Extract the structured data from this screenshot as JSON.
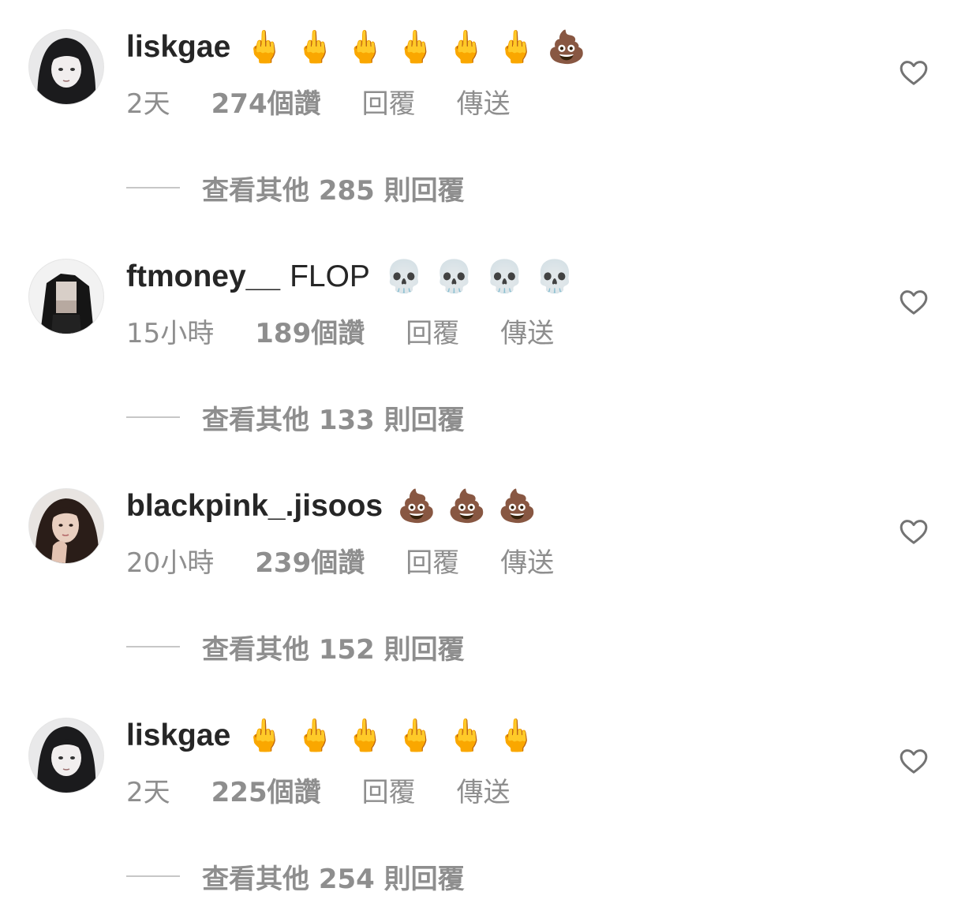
{
  "comments": [
    {
      "username": "liskgae",
      "text": "",
      "emojis": "🖕🖕🖕🖕🖕🖕💩",
      "time": "2天",
      "likes": "274個讚",
      "reply_label": "回覆",
      "send_label": "傳送",
      "view_replies": "查看其他 285 則回覆"
    },
    {
      "username": "ftmoney__",
      "text": "FLOP",
      "emojis": "💀💀💀💀",
      "time": "15小時",
      "likes": "189個讚",
      "reply_label": "回覆",
      "send_label": "傳送",
      "view_replies": "查看其他 133 則回覆"
    },
    {
      "username": "blackpink_.jisoos",
      "text": "",
      "emojis": "💩💩💩",
      "time": "20小時",
      "likes": "239個讚",
      "reply_label": "回覆",
      "send_label": "傳送",
      "view_replies": "查看其他 152 則回覆"
    },
    {
      "username": "liskgae",
      "text": "",
      "emojis": "🖕🖕🖕🖕🖕🖕",
      "time": "2天",
      "likes": "225個讚",
      "reply_label": "回覆",
      "send_label": "傳送",
      "view_replies": "查看其他 254 則回覆"
    }
  ],
  "icons": {
    "heart": "heart-outline-icon"
  },
  "colors": {
    "secondary_text": "#8e8e8e",
    "primary_text": "#262626",
    "divider": "#c7c7c7"
  }
}
